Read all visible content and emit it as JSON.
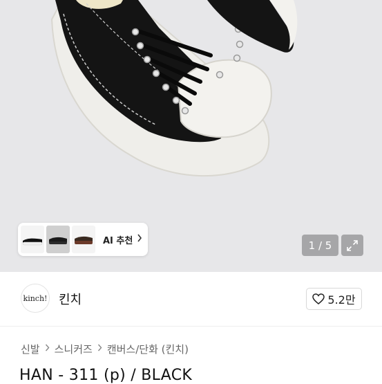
{
  "hero": {
    "ai_label": "AI 추천",
    "counter": "1 / 5"
  },
  "icons": {
    "ai_chevron": "chevron-right-icon",
    "expand": "expand-icon",
    "heart": "heart-icon",
    "breadcrumb_sep": "chevron-right-icon"
  },
  "brand": {
    "logo_text": "kinch!",
    "name": "킨치",
    "likes": "5.2만"
  },
  "breadcrumb": [
    "신발",
    "스니커즈",
    "캔버스/단화 (킨치)"
  ],
  "product": {
    "title": "HAN - 311 (p) / BLACK"
  }
}
